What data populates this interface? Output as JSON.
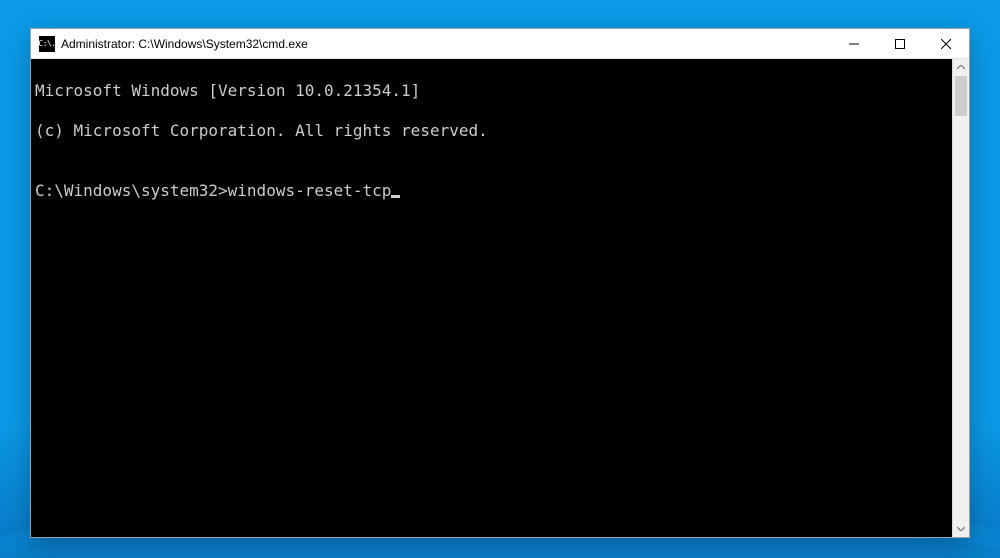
{
  "window": {
    "icon_text": "C:\\.",
    "title": "Administrator: C:\\Windows\\System32\\cmd.exe"
  },
  "terminal": {
    "banner_line1": "Microsoft Windows [Version 10.0.21354.1]",
    "banner_line2": "(c) Microsoft Corporation. All rights reserved.",
    "blank": "",
    "prompt_path": "C:\\Windows\\system32>",
    "command": "windows-reset-tcp"
  }
}
